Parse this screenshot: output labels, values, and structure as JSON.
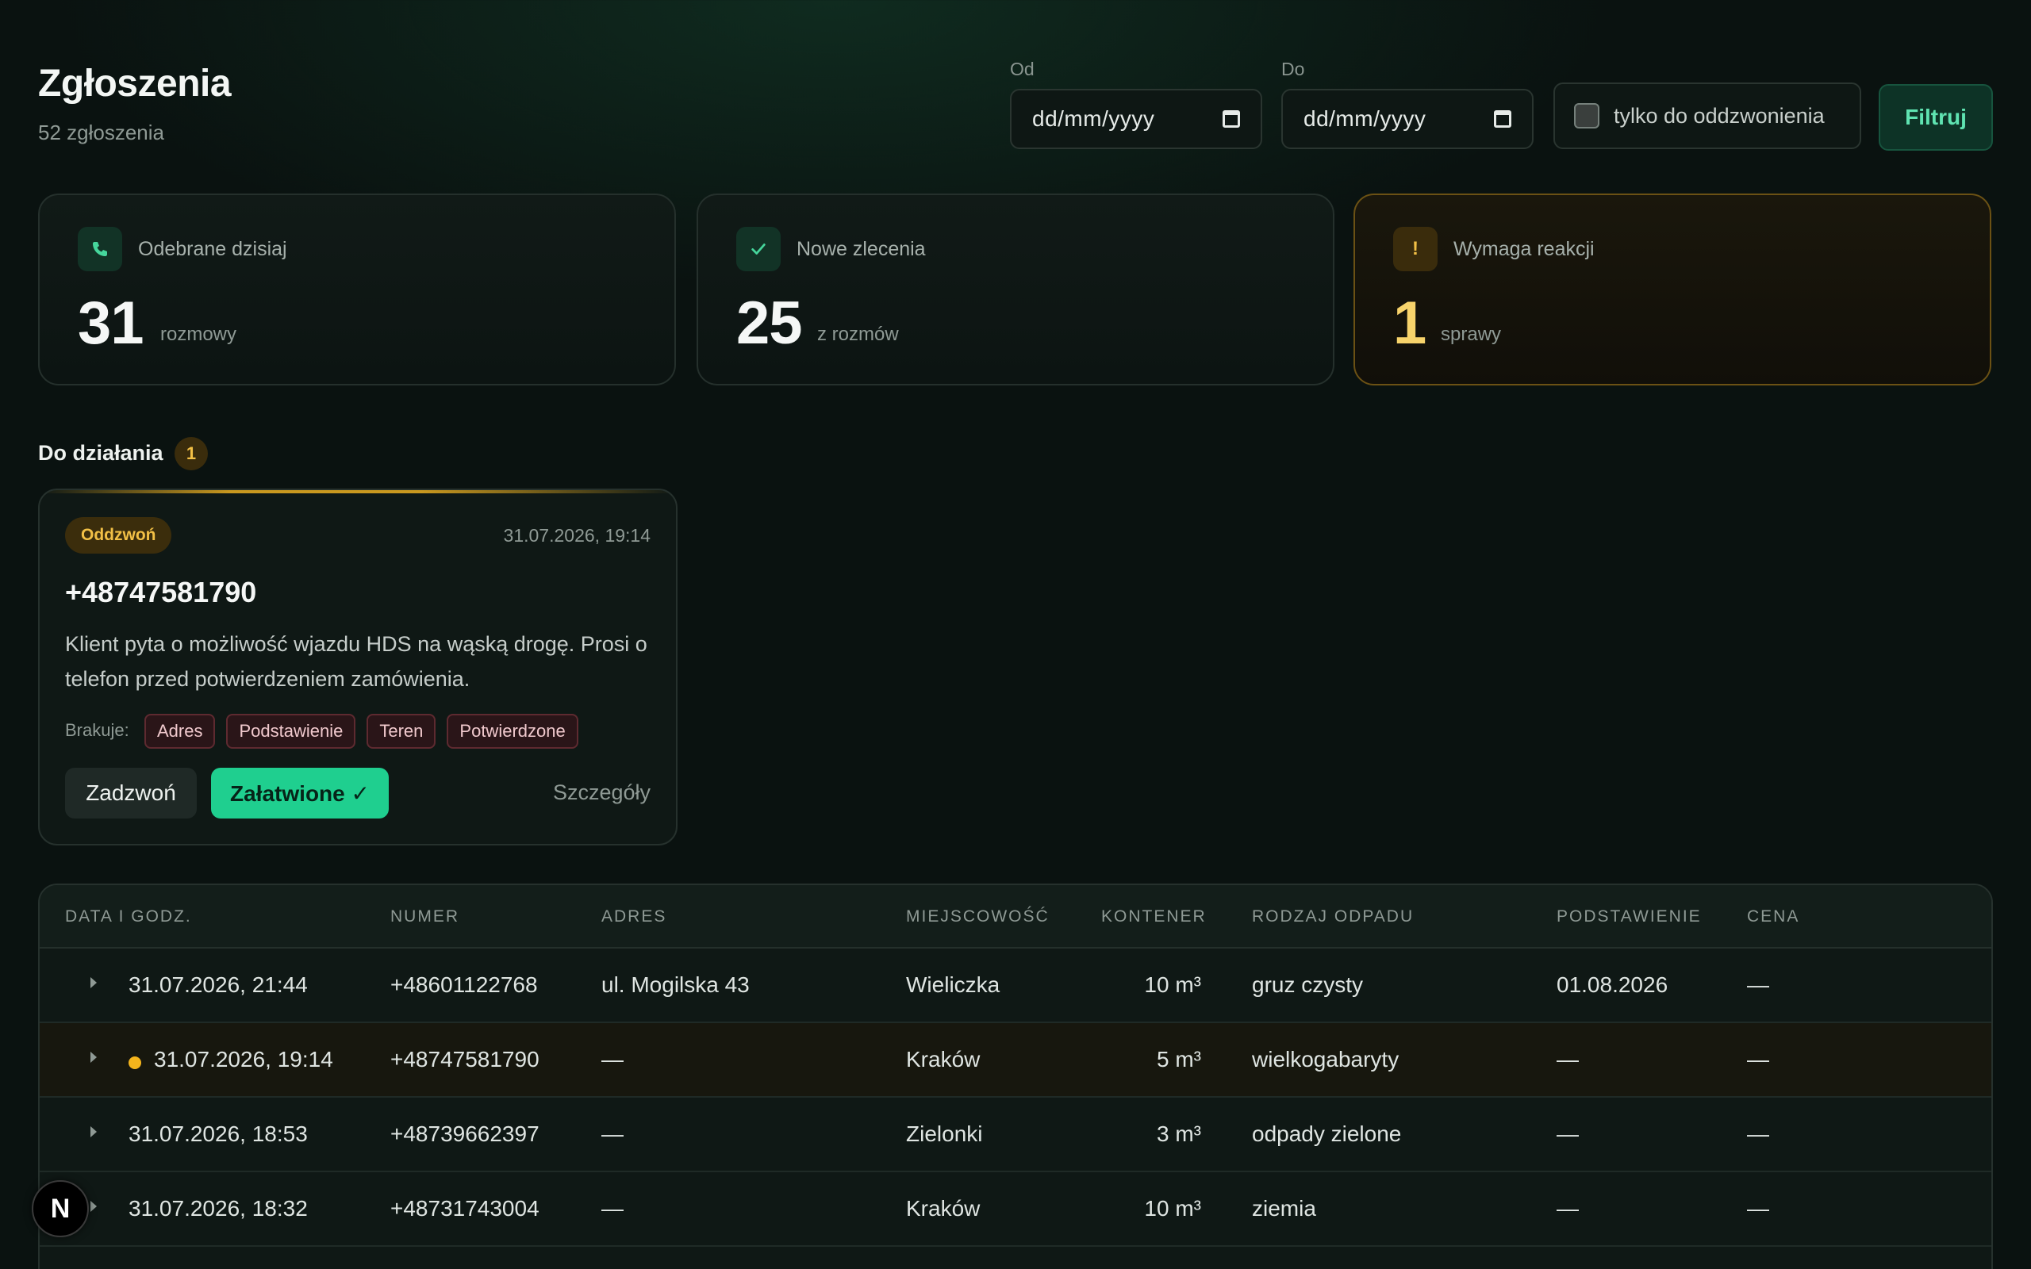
{
  "header": {
    "title": "Zgłoszenia",
    "subtitle": "52 zgłoszenia"
  },
  "filters": {
    "from_label": "Od",
    "from_value": "dd/mm/yyyy",
    "to_label": "Do",
    "to_value": "dd/mm/yyyy",
    "callback_only_label": "tylko do oddzwonienia",
    "callback_only_checked": false,
    "filter_button": "Filtruj"
  },
  "stats": [
    {
      "icon": "phone-icon",
      "label": "Odebrane dzisiaj",
      "value": "31",
      "unit": "rozmowy"
    },
    {
      "icon": "check-icon",
      "label": "Nowe zlecenia",
      "value": "25",
      "unit": "z rozmów"
    },
    {
      "icon": "exclamation-icon",
      "label": "Wymaga reakcji",
      "value": "1",
      "unit": "sprawy"
    }
  ],
  "action_section": {
    "title": "Do działania",
    "count": "1",
    "card": {
      "tag": "Oddzwoń",
      "time": "31.07.2026, 19:14",
      "phone": "+48747581790",
      "description": "Klient pyta o możliwość wjazdu HDS na wąską drogę. Prosi o telefon przed potwierdzeniem zamówienia.",
      "missing_label": "Brakuje:",
      "missing": [
        "Adres",
        "Podstawienie",
        "Teren",
        "Potwierdzone"
      ],
      "call_button": "Zadzwoń",
      "done_button": "Załatwione ✓",
      "details_link": "Szczegóły"
    }
  },
  "table": {
    "columns": [
      "DATA I GODZ.",
      "NUMER",
      "ADRES",
      "MIEJSCOWOŚĆ",
      "KONTENER",
      "RODZAJ ODPADU",
      "PODSTAWIENIE",
      "CENA"
    ],
    "rows": [
      {
        "datetime": "31.07.2026, 21:44",
        "number": "+48601122768",
        "address": "ul. Mogilska 43",
        "city": "Wieliczka",
        "container": "10 m³",
        "waste": "gruz czysty",
        "delivery": "01.08.2026",
        "price": "—",
        "flagged": false
      },
      {
        "datetime": "31.07.2026, 19:14",
        "number": "+48747581790",
        "address": "—",
        "city": "Kraków",
        "container": "5 m³",
        "waste": "wielkogabaryty",
        "delivery": "—",
        "price": "—",
        "flagged": true
      },
      {
        "datetime": "31.07.2026, 18:53",
        "number": "+48739662397",
        "address": "—",
        "city": "Zielonki",
        "container": "3 m³",
        "waste": "odpady zielone",
        "delivery": "—",
        "price": "—",
        "flagged": false
      },
      {
        "datetime": "31.07.2026, 18:32",
        "number": "+48731743004",
        "address": "—",
        "city": "Kraków",
        "container": "10 m³",
        "waste": "ziemia",
        "delivery": "—",
        "price": "—",
        "flagged": false
      }
    ]
  },
  "dev_badge": {
    "letter": "N"
  },
  "colors": {
    "background": "#0a1210",
    "accent_green": "#1fcf8f",
    "accent_amber": "#f2c046",
    "missing_chip": "#5e2a30"
  }
}
